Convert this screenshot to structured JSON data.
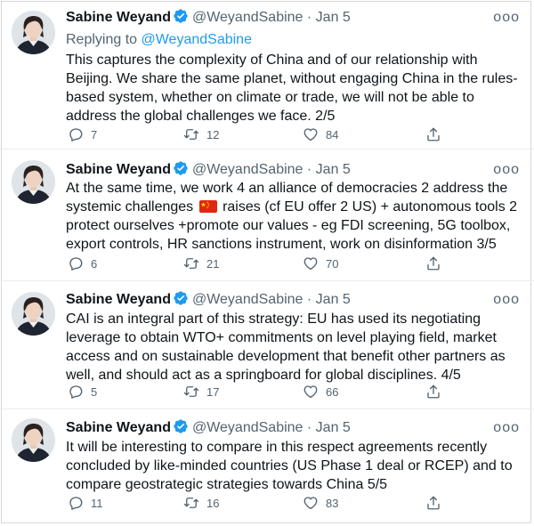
{
  "author": {
    "name": "Sabine Weyand",
    "handle": "@WeyandSabine",
    "separator": "·",
    "avatar_icon": "profile-photo",
    "verified_icon": "verified-badge-icon"
  },
  "colors": {
    "verified": "#1d9bf0",
    "link": "#1d9bf0",
    "muted": "#536471"
  },
  "tweets": [
    {
      "date": "Jan 5",
      "more": "ooo",
      "reply_prefix": "Replying to",
      "reply_handle": "@WeyandSabine",
      "text": "This captures the complexity of China and of our relationship with Beijing. We share the same planet, without engaging China in the rules-based system, whether on climate or trade, we will not be able to address the global challenges we face. 2/5",
      "replies": "7",
      "retweets": "12",
      "likes": "84"
    },
    {
      "date": "Jan 5",
      "more": "ooo",
      "text_before_flag": "At the same time, we work 4 an alliance of democracies 2 address the systemic challenges",
      "flag_icon": "china-flag-emoji",
      "text_after_flag": "raises (cf EU offer 2 US) + autonomous tools 2 protect ourselves +promote our values - eg FDI screening, 5G toolbox, export controls, HR sanctions instrument, work on disinformation 3/5",
      "replies": "6",
      "retweets": "21",
      "likes": "70"
    },
    {
      "date": "Jan 5",
      "more": "ooo",
      "text": "CAI is an integral part of this strategy: EU has used its negotiating leverage to obtain WTO+ commitments on level playing field, market access and on sustainable development that benefit other partners as well, and should act as a springboard for global disciplines. 4/5",
      "replies": "5",
      "retweets": "17",
      "likes": "66"
    },
    {
      "date": "Jan 5",
      "more": "ooo",
      "text": "It will be interesting to compare in this respect agreements recently concluded by like-minded countries (US Phase 1 deal or RCEP) and to compare geostrategic strategies towards China 5/5",
      "replies": "11",
      "retweets": "16",
      "likes": "83"
    }
  ]
}
